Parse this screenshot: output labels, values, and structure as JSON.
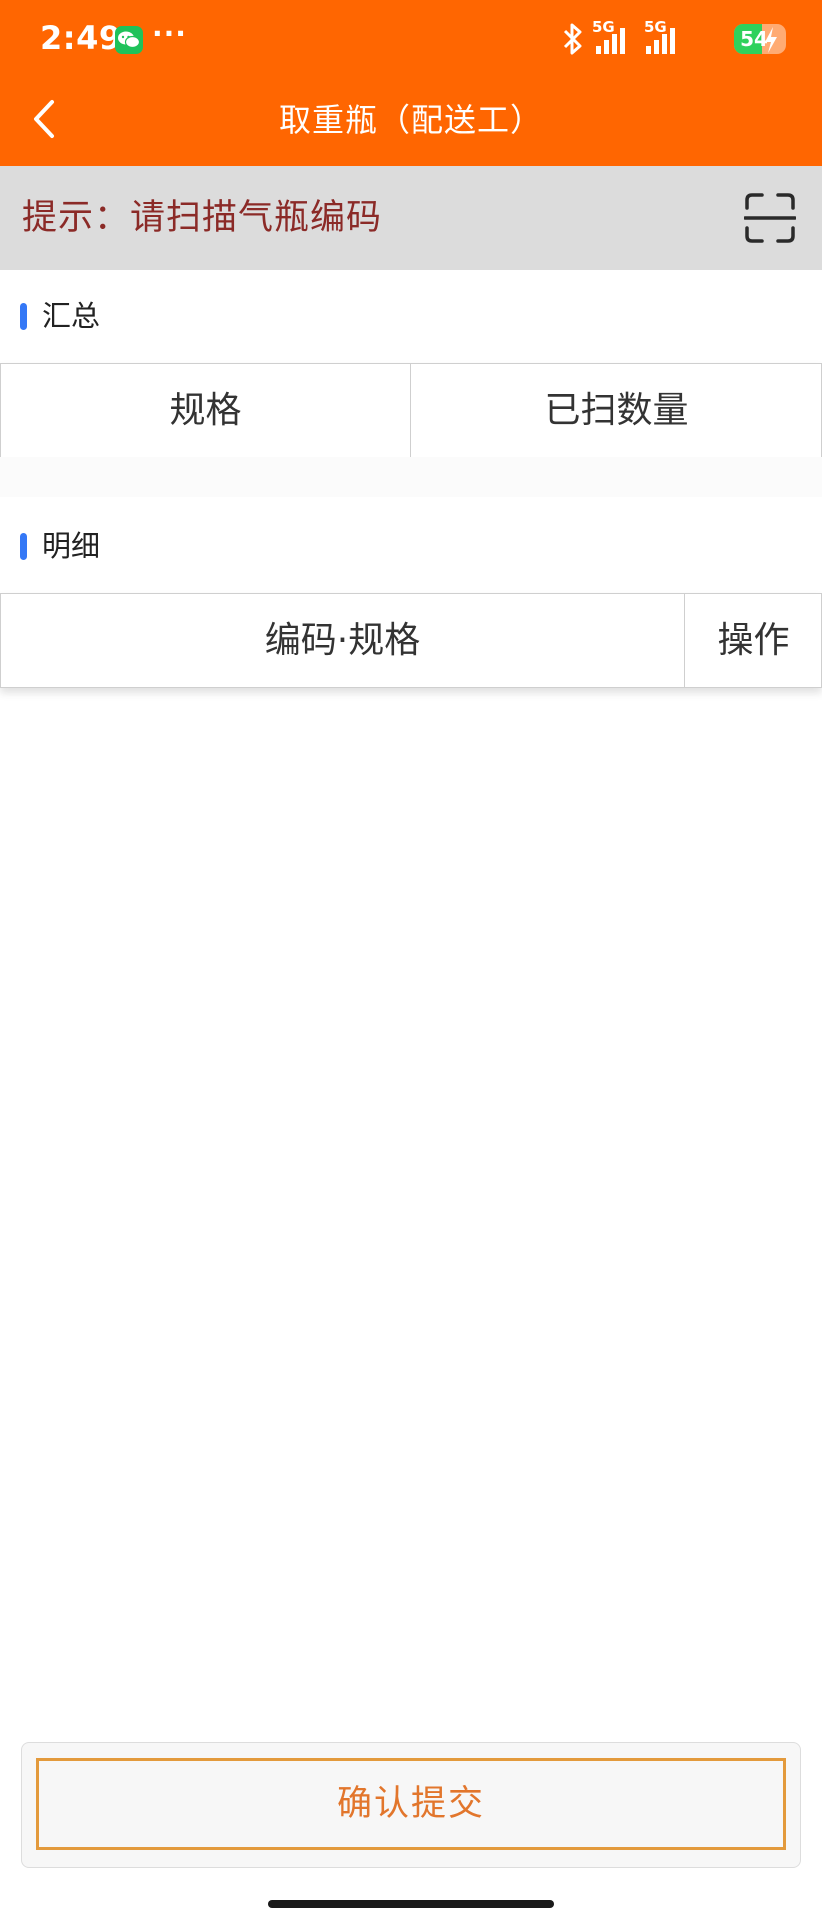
{
  "status_bar": {
    "time": "2:49",
    "more": "···",
    "network_1": "5G",
    "network_2": "5G",
    "battery": "54",
    "battery_level": 0.54
  },
  "nav": {
    "title": "取重瓶（配送工）",
    "back_icon": "chevron-left-icon"
  },
  "hint": {
    "text": "提示：请扫描气瓶编码",
    "scan_icon": "scan-frame-icon"
  },
  "summary": {
    "title": "汇总",
    "columns": [
      "规格",
      "已扫数量"
    ]
  },
  "detail": {
    "title": "明细",
    "columns": [
      "编码·规格",
      "操作"
    ]
  },
  "submit": {
    "label": "确认提交"
  },
  "colors": {
    "header": "#ff6601",
    "hint_bg": "#dcdcdc",
    "hint_text": "#8b2a27",
    "section_marker": "#3478f6",
    "submit_border": "#e39a3c",
    "submit_text": "#e2762c",
    "battery": "#2fd15c",
    "wechat": "#1fc25a"
  }
}
